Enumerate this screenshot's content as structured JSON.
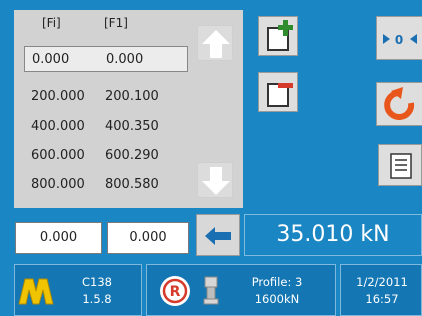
{
  "table": {
    "headers": [
      "[Fi]",
      "[F1]"
    ],
    "rows": [
      {
        "fi": "0.000",
        "f1": "0.000"
      },
      {
        "fi": "200.000",
        "f1": "200.100"
      },
      {
        "fi": "400.000",
        "f1": "400.350"
      },
      {
        "fi": "600.000",
        "f1": "600.290"
      },
      {
        "fi": "800.000",
        "f1": "800.580"
      }
    ],
    "selected_row": 0
  },
  "inputs": {
    "fi_value": "0.000",
    "f1_value": "0.000"
  },
  "display": {
    "force": "35.010 kN"
  },
  "toolbar": {
    "zero_label": "0"
  },
  "status": {
    "model": "C138",
    "version": "1.5.8",
    "profile": "Profile: 3",
    "capacity": "1600kN",
    "date": "1/2/2011",
    "time": "16:57",
    "r_badge": "R"
  },
  "colors": {
    "background": "#1b86c4",
    "logo": "#f0c400",
    "add_accent": "#2e8b2e",
    "remove_accent": "#d63a2a",
    "reset_accent": "#e8561c"
  },
  "icons": [
    "arrow-up-icon",
    "arrow-down-icon",
    "add-row-icon",
    "remove-row-icon",
    "zero-icon",
    "reset-icon",
    "report-icon",
    "enter-arrow-icon",
    "logo-icon",
    "r-icon",
    "sensor-icon"
  ]
}
